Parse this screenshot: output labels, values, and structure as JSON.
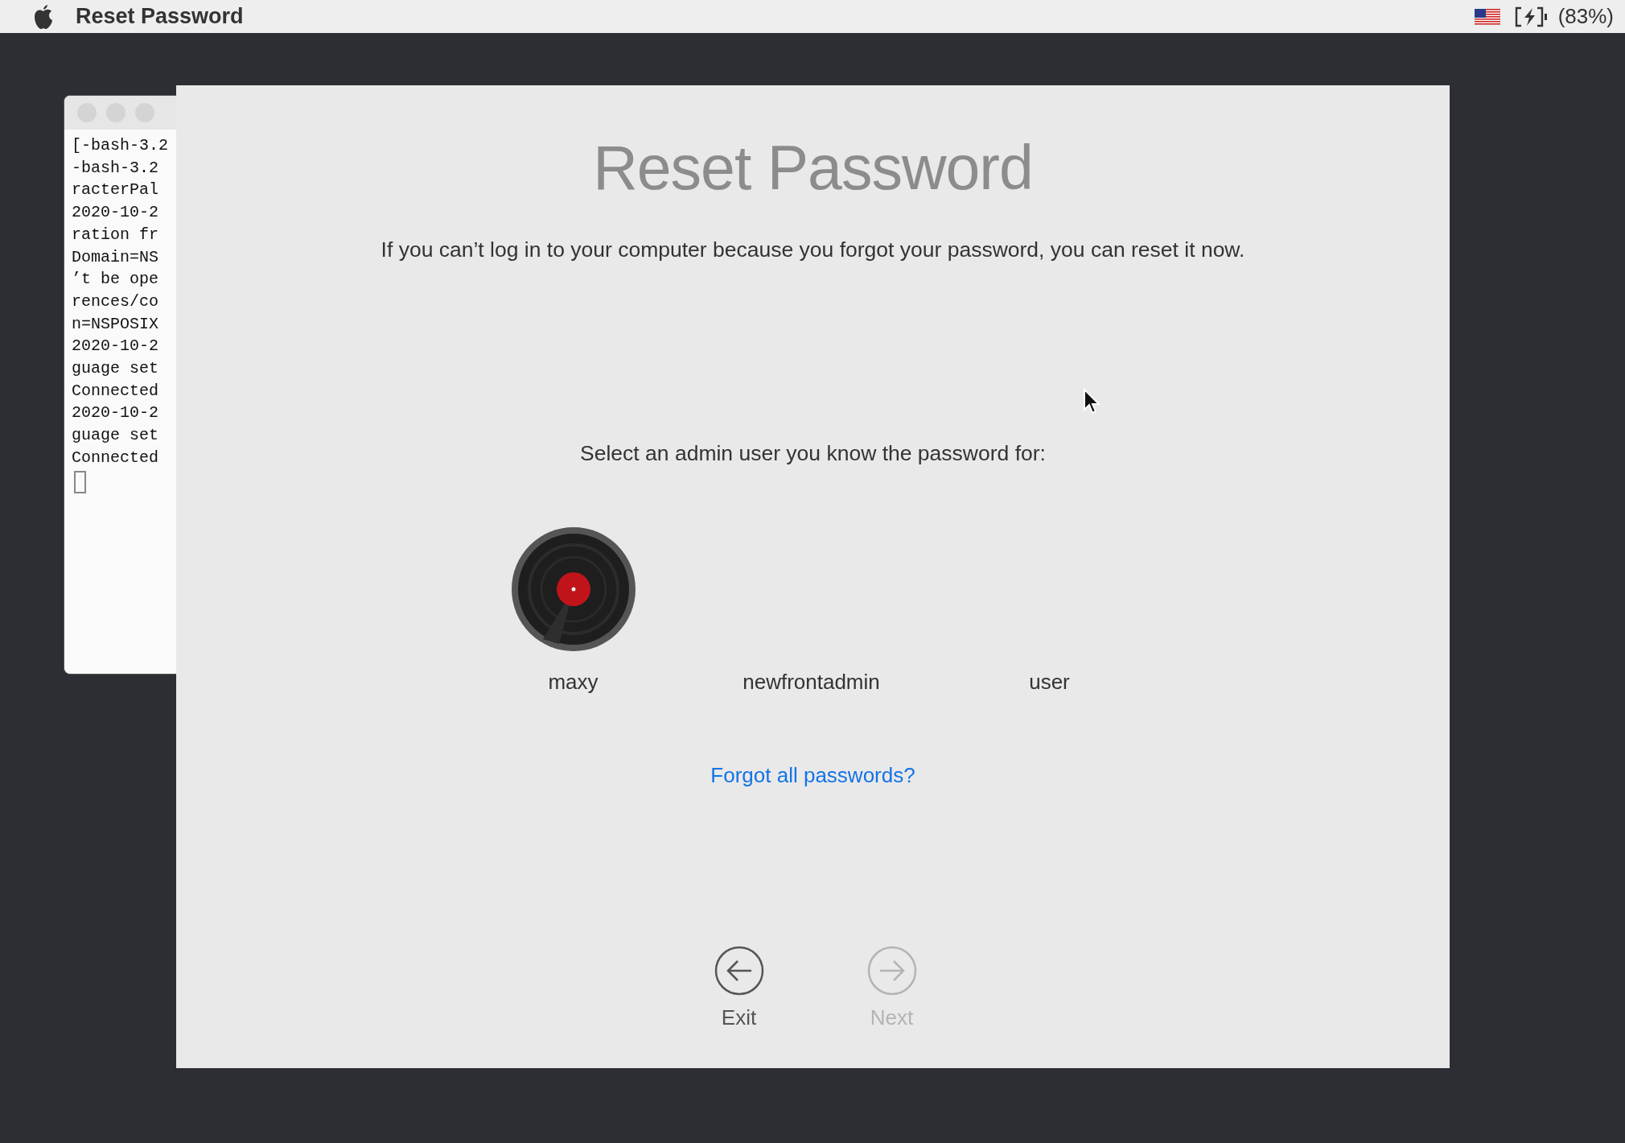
{
  "menu_bar": {
    "app_name": "Reset Password",
    "battery": "(83%)"
  },
  "terminal": {
    "lines": [
      "[-bash-3.2",
      "-bash-3.2",
      "racterPal",
      "2020-10-2",
      "ration fr",
      "Domain=NS",
      "’t be ope",
      "rences/co",
      "n=NSPOSIX",
      "2020-10-2",
      "guage set",
      "Connected",
      "2020-10-2",
      "guage set",
      "Connected"
    ]
  },
  "window": {
    "title": "Reset Password",
    "description": "If you can’t log in to your computer because you forgot your password, you can reset it now.",
    "prompt": "Select an admin user you know the password for:",
    "users": [
      {
        "name": "maxy",
        "avatar": true
      },
      {
        "name": "newfrontadmin",
        "avatar": false
      },
      {
        "name": "user",
        "avatar": false
      }
    ],
    "link": "Forgot all passwords?",
    "buttons": [
      {
        "label": "Exit",
        "kind": "back",
        "disabled": false
      },
      {
        "label": "Next",
        "kind": "forward",
        "disabled": true
      }
    ]
  }
}
